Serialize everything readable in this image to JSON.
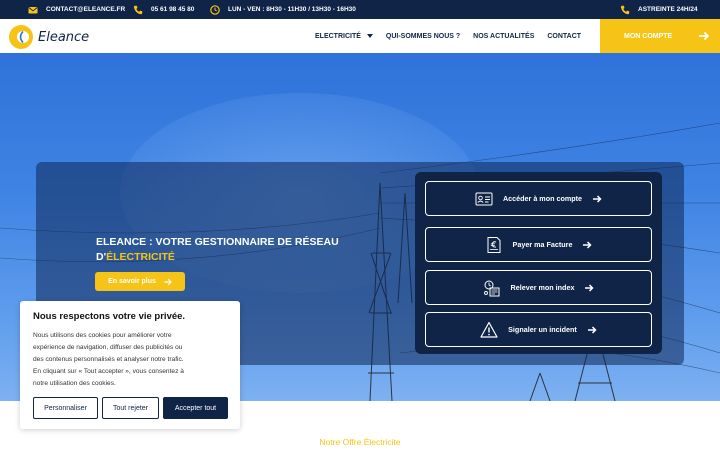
{
  "topbar": {
    "email": "CONTACT@ELEANCE.FR",
    "phone": "05 61 98 45 80",
    "hours": "LUN - VEN : 8H30 - 11H30 / 13H30 - 16H30",
    "on_call": "ASTREINTE 24H/24",
    "icons": [
      "envelope-icon",
      "phone-icon",
      "clock-icon",
      "phone-icon"
    ]
  },
  "header": {
    "logo_text": "Eleance",
    "nav": [
      {
        "label": "ELECTRICITÉ",
        "has_dropdown": true
      },
      {
        "label": "QUI-SOMMES NOUS ?"
      },
      {
        "label": "NOS ACTUALITÉS"
      },
      {
        "label": "CONTACT"
      }
    ],
    "cta_label": "MON COMPTE"
  },
  "hero": {
    "title_line1": "ELEANCE : VOTRE GESTIONNAIRE DE RÉSEAU",
    "title_prefix": "D'",
    "title_accent": "ÉLECTRICITÉ",
    "button_label": "En savoir plus",
    "actions": [
      {
        "label": "Accéder à mon compte",
        "icon": "account-card-icon"
      },
      {
        "label": "Payer ma Facture",
        "icon": "invoice-euro-icon"
      },
      {
        "label": "Relever mon index",
        "icon": "meter-reading-icon"
      },
      {
        "label": "Signaler un incident",
        "icon": "warning-icon"
      }
    ]
  },
  "cookie": {
    "title": "Nous respectons votre vie privée.",
    "text_lines": [
      "Nous utilisons des cookies pour améliorer votre",
      "expérience de navigation, diffuser des publicités ou",
      "des contenus personnalisés et analyser notre trafic.",
      "En cliquant sur « Tout accepter », vous consentez à",
      "notre utilisation des cookies."
    ],
    "btn_customize": "Personnaliser",
    "btn_reject": "Tout rejeter",
    "btn_accept": "Accepter tout"
  },
  "offer": {
    "title": "Notre Offre Électricite"
  },
  "colors": {
    "navy": "#0f2447",
    "yellow": "#f6c417",
    "sky": "#3f84e4"
  }
}
